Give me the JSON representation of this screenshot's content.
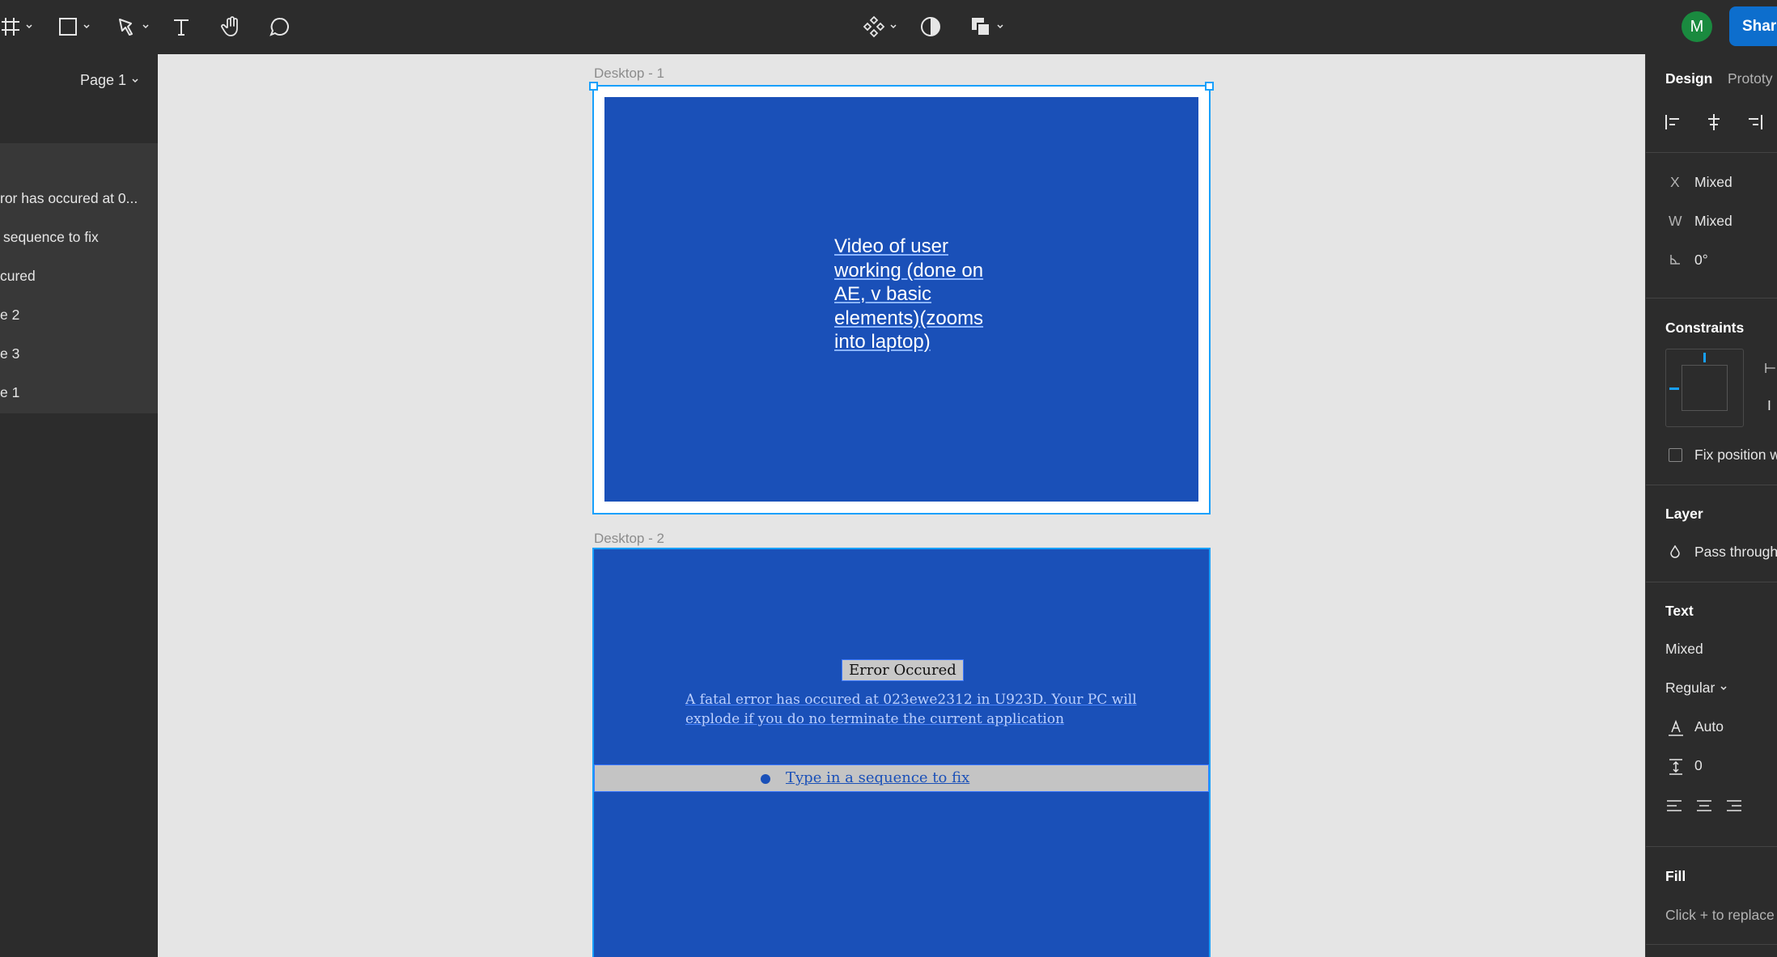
{
  "toolbar": {
    "avatar_initial": "M",
    "share_label": "Share",
    "icons": [
      "frame-icon",
      "rectangle-icon",
      "pen-icon",
      "text-icon",
      "hand-icon",
      "comment-icon",
      "component-icon",
      "contrast-icon",
      "boolean-icon"
    ]
  },
  "sidebar": {
    "page_label": "Page 1",
    "layers": [
      "ror has occured at 0...",
      "sequence to fix",
      "cured",
      "e 2",
      "e 3",
      "e 1"
    ]
  },
  "canvas": {
    "frame1_label": "Desktop - 1",
    "frame1_text": "Video of user working (done on AE, v basic elements)(zooms into laptop)",
    "frame2_label": "Desktop - 2",
    "error_title": "Error Occured",
    "error_body": "A fatal error has occured at 023ewe2312 in U923D. Your PC will explode if you do no terminate the current application",
    "sequence_text": "Type in a sequence to fix"
  },
  "right_panel": {
    "tab_design": "Design",
    "tab_prototype": "Prototy",
    "x_label": "X",
    "x_value": "Mixed",
    "w_label": "W",
    "w_value": "Mixed",
    "rotation_value": "0°",
    "constraints_heading": "Constraints",
    "fix_position_label": "Fix position w",
    "layer_heading": "Layer",
    "layer_blend": "Pass through",
    "text_heading": "Text",
    "font_value": "Mixed",
    "weight_value": "Regular",
    "line_height_value": "Auto",
    "spacing_value": "0",
    "fill_heading": "Fill",
    "fill_hint": "Click + to replace"
  },
  "colors": {
    "accent": "#18a0fb",
    "frame_blue": "#1a50b8",
    "share_blue": "#0d6ecd",
    "avatar_green": "#1a8a3f"
  }
}
